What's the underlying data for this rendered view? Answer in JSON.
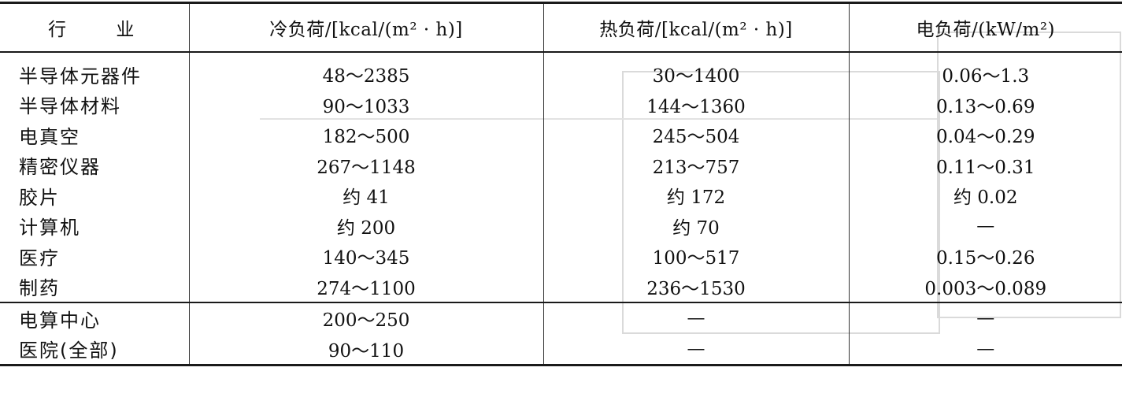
{
  "headers": {
    "industry": "行 业",
    "cooling": "冷负荷/[kcal/(m² · h)]",
    "heating": "热负荷/[kcal/(m² · h)]",
    "electric": "电负荷/(kW/m²)"
  },
  "rows": [
    {
      "industry": "半导体元器件",
      "cooling": "48～2385",
      "heating": "30～1400",
      "electric": "0.06～1.3"
    },
    {
      "industry": "半导体材料",
      "cooling": "90～1033",
      "heating": "144～1360",
      "electric": "0.13～0.69"
    },
    {
      "industry": "电真空",
      "cooling": "182～500",
      "heating": "245～504",
      "electric": "0.04～0.29"
    },
    {
      "industry": "精密仪器",
      "cooling": "267～1148",
      "heating": "213～757",
      "electric": "0.11～0.31"
    },
    {
      "industry": "胶片",
      "cooling": "约 41",
      "heating": "约 172",
      "electric": "约 0.02"
    },
    {
      "industry": "计算机",
      "cooling": "约 200",
      "heating": "约 70",
      "electric": "—"
    },
    {
      "industry": "医疗",
      "cooling": "140～345",
      "heating": "100～517",
      "electric": "0.15～0.26"
    },
    {
      "industry": "制药",
      "cooling": "274～1100",
      "heating": "236～1530",
      "electric": "0.003～0.089"
    },
    {
      "industry": "电算中心",
      "cooling": "200～250",
      "heating": "—",
      "electric": "—"
    },
    {
      "industry": "医院(全部)",
      "cooling": "90～110",
      "heating": "—",
      "electric": "—"
    }
  ]
}
